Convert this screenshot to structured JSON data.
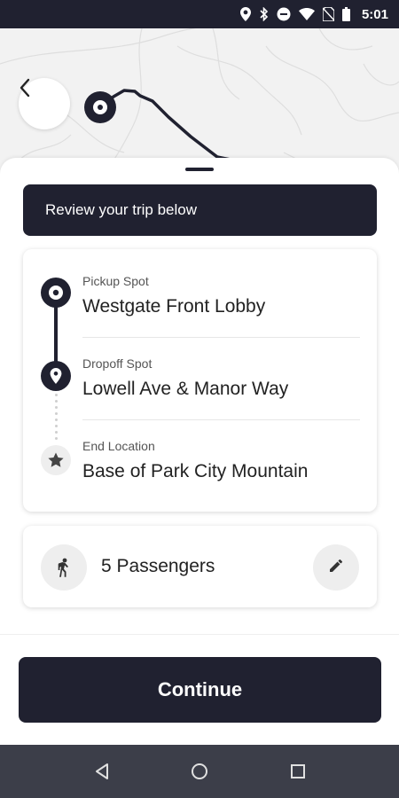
{
  "status_bar": {
    "time": "5:01",
    "icons": [
      "location-icon",
      "bluetooth-icon",
      "do-not-disturb-icon",
      "wifi-icon",
      "no-sim-icon",
      "battery-icon"
    ]
  },
  "map": {
    "back_icon": "chevron-left-icon"
  },
  "banner": {
    "text": "Review your trip below"
  },
  "stops": [
    {
      "label": "Pickup Spot",
      "value": "Westgate Front Lobby",
      "icon": "pickup-dot-icon"
    },
    {
      "label": "Dropoff Spot",
      "value": "Lowell Ave & Manor Way",
      "icon": "dropoff-pin-icon"
    },
    {
      "label": "End Location",
      "value": "Base of Park City Mountain",
      "icon": "star-icon"
    }
  ],
  "passengers": {
    "text": "5 Passengers",
    "icon": "person-icon",
    "edit_icon": "pencil-icon"
  },
  "continue": {
    "label": "Continue"
  },
  "nav": {
    "back_icon": "nav-back-icon",
    "home_icon": "nav-home-icon",
    "recents_icon": "nav-recents-icon"
  },
  "colors": {
    "dark": "#202130",
    "navbar": "#3c3e49",
    "map_bg": "#f2f2f2"
  }
}
